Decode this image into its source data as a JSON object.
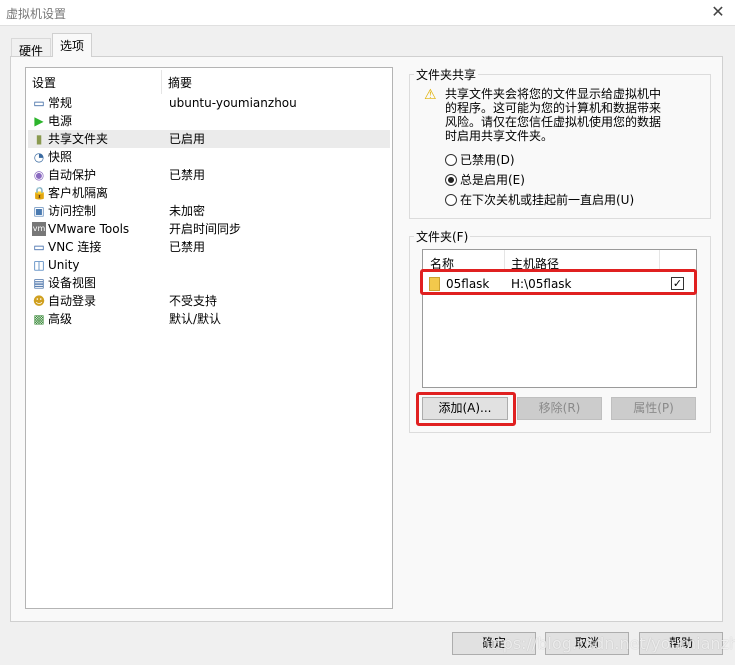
{
  "window": {
    "title": "虚拟机设置",
    "close_icon": "close-icon"
  },
  "tabs": [
    {
      "label": "硬件"
    },
    {
      "label": "选项",
      "active": true
    }
  ],
  "settings_list": {
    "headers": {
      "setting": "设置",
      "summary": "摘要"
    },
    "items": [
      {
        "name": "常规",
        "summary": "ubuntu-youmianzhou",
        "icon": "monitor-icon"
      },
      {
        "name": "电源",
        "summary": "",
        "icon": "play-icon"
      },
      {
        "name": "共享文件夹",
        "summary": "已启用",
        "icon": "shared-folder-icon",
        "selected": true
      },
      {
        "name": "快照",
        "summary": "",
        "icon": "snapshot-icon"
      },
      {
        "name": "自动保护",
        "summary": "已禁用",
        "icon": "autoprotect-icon"
      },
      {
        "name": "客户机隔离",
        "summary": "",
        "icon": "lock-icon"
      },
      {
        "name": "访问控制",
        "summary": "未加密",
        "icon": "access-control-icon"
      },
      {
        "name": "VMware Tools",
        "summary": "开启时间同步",
        "icon": "vm-icon"
      },
      {
        "name": "VNC 连接",
        "summary": "已禁用",
        "icon": "vnc-icon"
      },
      {
        "name": "Unity",
        "summary": "",
        "icon": "unity-icon"
      },
      {
        "name": "设备视图",
        "summary": "",
        "icon": "device-view-icon"
      },
      {
        "name": "自动登录",
        "summary": "不受支持",
        "icon": "autologin-icon"
      },
      {
        "name": "高级",
        "summary": "默认/默认",
        "icon": "advanced-icon"
      }
    ]
  },
  "sharing": {
    "legend": "文件夹共享",
    "warning_lines": [
      "共享文件夹会将您的文件显示给虚拟机中",
      "的程序。这可能为您的计算机和数据带来",
      "风险。请仅在您信任虚拟机使用您的数据",
      "时启用共享文件夹。"
    ],
    "options": [
      {
        "label": "已禁用(D)",
        "checked": false
      },
      {
        "label": "总是启用(E)",
        "checked": true
      },
      {
        "label": "在下次关机或挂起前一直启用(U)",
        "checked": false
      }
    ]
  },
  "folders": {
    "legend": "文件夹(F)",
    "headers": {
      "name": "名称",
      "host_path": "主机路径"
    },
    "rows": [
      {
        "name": "05flask",
        "host_path": "H:\\05flask",
        "enabled": true
      }
    ],
    "add_label": "添加(A)...",
    "remove_label": "移除(R)",
    "properties_label": "属性(P)"
  },
  "footer": {
    "ok": "确定",
    "cancel": "取消",
    "help": "帮助"
  },
  "watermark": "https://blog.csdn.net/youmianzhou",
  "colors": {
    "highlight": "#e02020"
  }
}
